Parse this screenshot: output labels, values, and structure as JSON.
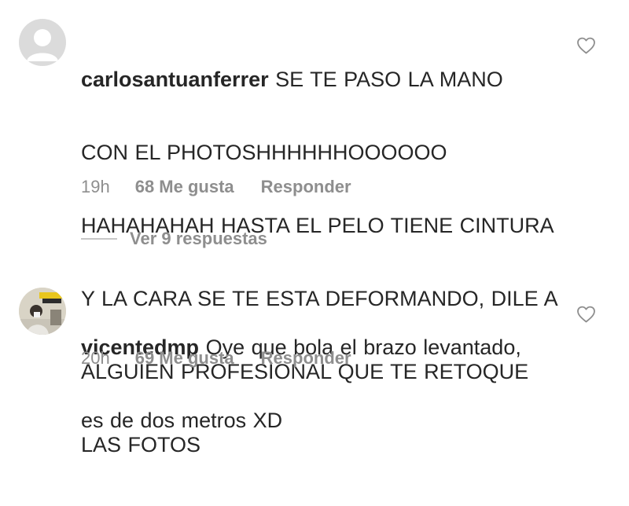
{
  "comments": [
    {
      "username": "carlosantuanferrer",
      "text_lines": [
        "SE TE PASO LA MANO",
        "CON EL PHOTOSHHHHHHOOOOOO",
        "HAHAHAHAH HASTA EL PELO TIENE CINTURA",
        "Y LA CARA SE TE ESTA DEFORMANDO, DILE A",
        "ALGUIEN PROFESIONAL QUE TE RETOQUE",
        "LAS FOTOS"
      ],
      "time": "19h",
      "likes": "68 Me gusta",
      "reply_label": "Responder",
      "view_replies": "Ver 9 respuestas"
    },
    {
      "username": "vicentedmp",
      "text_lines": [
        "Oye que bola el brazo levantado,",
        "es de dos metros XD"
      ],
      "time": "20h",
      "likes": "69 Me gusta",
      "reply_label": "Responder"
    }
  ],
  "icons": {
    "like": "heart-outline-icon",
    "default_avatar": "default-user-avatar-icon"
  },
  "colors": {
    "text": "#262626",
    "secondary": "#8e8e8e",
    "avatar_placeholder": "#dbdbdb"
  }
}
